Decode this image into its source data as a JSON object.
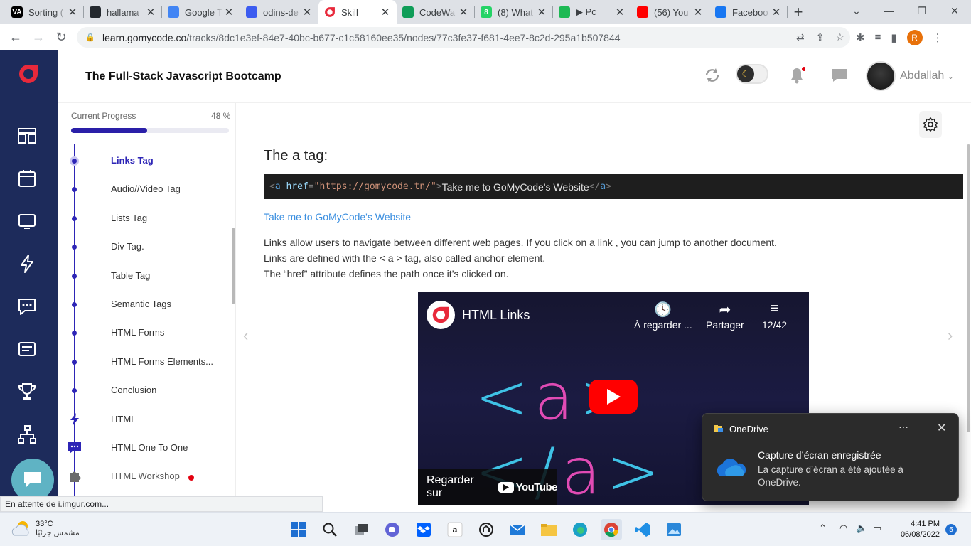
{
  "browser": {
    "tabs": [
      {
        "title": "Sorting (",
        "fav_bg": "#000000",
        "fav_text": "VA",
        "active": false
      },
      {
        "title": "hallama",
        "fav_bg": "#24292f",
        "fav_text": "",
        "active": false
      },
      {
        "title": "Google T",
        "fav_bg": "#4285f4",
        "fav_text": "",
        "active": false
      },
      {
        "title": "odins-de",
        "fav_bg": "#3c5cf0",
        "fav_text": "",
        "active": false
      },
      {
        "title": "Skill",
        "fav_bg": "#ffffff",
        "fav_text": "",
        "active": true
      },
      {
        "title": "CodeWa",
        "fav_bg": "#0f9d58",
        "fav_text": "",
        "active": false
      },
      {
        "title": "(8) What",
        "fav_bg": "#25d366",
        "fav_text": "8",
        "active": false
      },
      {
        "title": "▶ Pc",
        "fav_bg": "#1db954",
        "fav_text": "",
        "active": false
      },
      {
        "title": "(56) You",
        "fav_bg": "#ff0000",
        "fav_text": "",
        "active": false
      },
      {
        "title": "Faceboo",
        "fav_bg": "#1877f2",
        "fav_text": "",
        "active": false
      }
    ],
    "url_host": "learn.gomycode.co",
    "url_path": "/tracks/8dc1e3ef-84e7-40bc-b677-c1c58160ee35/nodes/77c3fe37-f681-4ee7-8c2d-295a1b507844",
    "profile_initial": "R",
    "status_text": "En attente de i.imgur.com..."
  },
  "app": {
    "title": "The Full-Stack Javascript Bootcamp",
    "username": "Abdallah",
    "progress_label": "Current Progress",
    "progress_value_text": "48 %",
    "progress_fraction": 0.48,
    "lessons": [
      {
        "label": "Links Tag",
        "active": true,
        "icon": "dot"
      },
      {
        "label": "Audio//Video Tag",
        "icon": "dot"
      },
      {
        "label": "Lists Tag",
        "icon": "dot"
      },
      {
        "label": "Div Tag.",
        "icon": "dot"
      },
      {
        "label": "Table Tag",
        "icon": "dot"
      },
      {
        "label": "Semantic Tags",
        "icon": "dot"
      },
      {
        "label": "HTML Forms",
        "icon": "dot"
      },
      {
        "label": "HTML Forms Elements...",
        "icon": "dot"
      },
      {
        "label": "Conclusion",
        "icon": "dot"
      },
      {
        "label": "HTML",
        "icon": "lightning-icon"
      },
      {
        "label": "HTML One To One",
        "icon": "chat-icon"
      },
      {
        "label": "HTML Workshop",
        "icon": "puzzle-icon",
        "badge": true
      }
    ]
  },
  "content": {
    "heading": "The a tag:",
    "code": {
      "open_lt": "<",
      "tag": "a",
      "attr": "href",
      "eq": "=",
      "value": "\"https://gomycode.tn/\"",
      "open_gt": ">",
      "text": "Take me to GoMyCode's Website",
      "close_lt": "</",
      "close_tag": "a",
      "close_gt": ">"
    },
    "demo_link": "Take me to GoMyCode's Website",
    "paragraphs": [
      "Links allow users to navigate between different web pages. If you click on a link , you can jump to another document.",
      "Links are defined with the < a > tag, also called anchor element.",
      "The “href” attribute defines the path once it’s clicked on."
    ],
    "video": {
      "title": "HTML Links",
      "watch_later": "À regarder ...",
      "share": "Partager",
      "playlist_count": "12/42",
      "watch_on": "Regarder sur",
      "youtube": "YouTube",
      "big_text_parts": [
        "<",
        "a",
        ">",
        "</",
        "a",
        ">"
      ]
    }
  },
  "toast": {
    "app": "OneDrive",
    "headline": "Capture d’écran enregistrée",
    "body": "La capture d’écran a été ajoutée à OneDrive."
  },
  "taskbar": {
    "temperature": "33°C",
    "weather_text": "مشمس جزئيًا",
    "time": "4:41 PM",
    "date": "06/08/2022",
    "notification_count": "5"
  },
  "colors": {
    "rail": "#1d2b5b",
    "accent": "#2d25b6",
    "brand_red": "#e8293b",
    "link": "#3b8fe0"
  }
}
